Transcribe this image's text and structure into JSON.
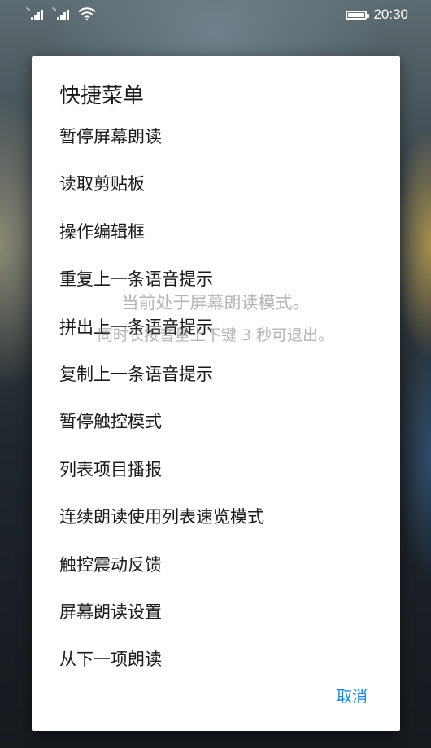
{
  "status_bar": {
    "sim1_label": "S",
    "sim2_label": "S",
    "signal_icon": "cell-signal-icon",
    "wifi_icon": "wifi-icon",
    "battery_icon": "battery-icon",
    "battery_level": 1.0,
    "time": "20:30"
  },
  "dialog": {
    "title": "快捷菜单",
    "items": [
      "暂停屏幕朗读",
      "读取剪贴板",
      "操作编辑框",
      "重复上一条语音提示",
      "拼出上一条语音提示",
      "复制上一条语音提示",
      "暂停触控模式",
      "列表项目播报",
      "连续朗读使用列表速览模式",
      "触控震动反馈",
      "屏幕朗读设置",
      "从下一项朗读"
    ],
    "cancel_label": "取消",
    "accent_color": "#1a87d8"
  },
  "toast": {
    "line1": "当前处于屏幕朗读模式。",
    "line2": "同时长按音量上下键 3 秒可退出。"
  }
}
